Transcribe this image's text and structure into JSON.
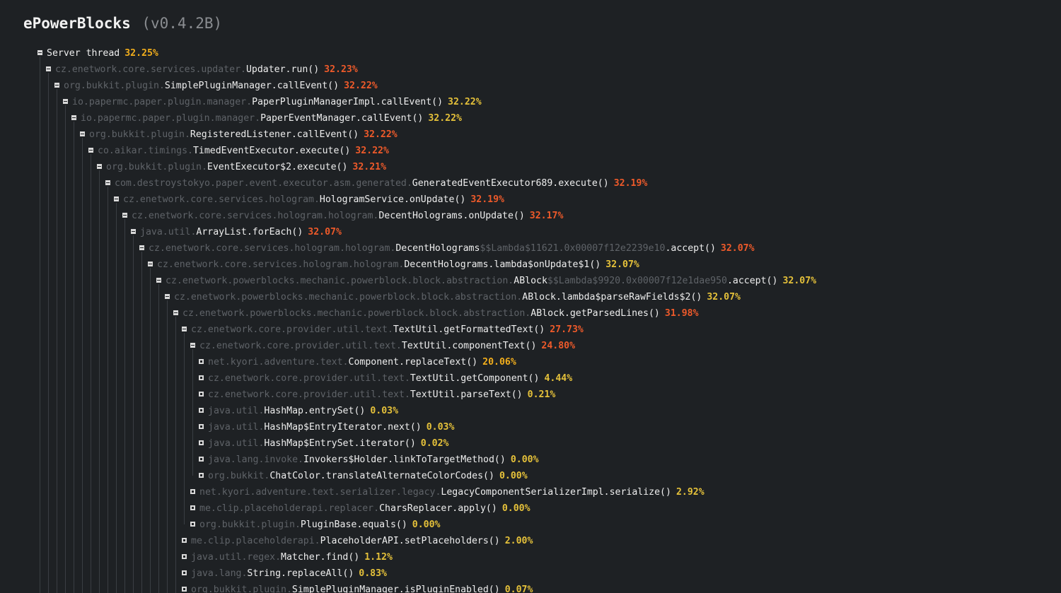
{
  "header": {
    "title": "ePowerBlocks",
    "version": "(v0.4.2B)"
  },
  "colors": {
    "background": "#1e2124",
    "package": "#5f6368",
    "method": "#eeeeee",
    "percent_high": "#ee5a2a",
    "percent_mid": "#f2ae1c",
    "percent_low": "#e5c13a"
  },
  "tree": [
    {
      "depth": 0,
      "expanded": true,
      "pkg": "",
      "cls": "Server thread",
      "pct": "32.25%",
      "heat": "mid"
    },
    {
      "depth": 1,
      "expanded": true,
      "pkg": "cz.enetwork.core.services.updater.",
      "cls": "Updater.run()",
      "pct": "32.23%",
      "heat": "high"
    },
    {
      "depth": 2,
      "expanded": true,
      "pkg": "org.bukkit.plugin.",
      "cls": "SimplePluginManager.callEvent()",
      "pct": "32.22%",
      "heat": "high"
    },
    {
      "depth": 3,
      "expanded": true,
      "pkg": "io.papermc.paper.plugin.manager.",
      "cls": "PaperPluginManagerImpl.callEvent()",
      "pct": "32.22%",
      "heat": "low"
    },
    {
      "depth": 4,
      "expanded": true,
      "pkg": "io.papermc.paper.plugin.manager.",
      "cls": "PaperEventManager.callEvent()",
      "pct": "32.22%",
      "heat": "low"
    },
    {
      "depth": 5,
      "expanded": true,
      "pkg": "org.bukkit.plugin.",
      "cls": "RegisteredListener.callEvent()",
      "pct": "32.22%",
      "heat": "high"
    },
    {
      "depth": 6,
      "expanded": true,
      "pkg": "co.aikar.timings.",
      "cls": "TimedEventExecutor.execute()",
      "pct": "32.22%",
      "heat": "high"
    },
    {
      "depth": 7,
      "expanded": true,
      "pkg": "org.bukkit.plugin.",
      "cls": "EventExecutor$2.execute()",
      "pct": "32.21%",
      "heat": "high"
    },
    {
      "depth": 8,
      "expanded": true,
      "pkg": "com.destroystokyo.paper.event.executor.asm.generated.",
      "cls": "GeneratedEventExecutor689.execute()",
      "pct": "32.19%",
      "heat": "high"
    },
    {
      "depth": 9,
      "expanded": true,
      "pkg": "cz.enetwork.core.services.hologram.",
      "cls": "HologramService.onUpdate()",
      "pct": "32.19%",
      "heat": "high"
    },
    {
      "depth": 10,
      "expanded": true,
      "pkg": "cz.enetwork.core.services.hologram.hologram.",
      "cls": "DecentHolograms.onUpdate()",
      "pct": "32.17%",
      "heat": "high"
    },
    {
      "depth": 11,
      "expanded": true,
      "pkg": "java.util.",
      "cls": "ArrayList.forEach()",
      "pct": "32.07%",
      "heat": "high"
    },
    {
      "depth": 12,
      "expanded": true,
      "pkg": "cz.enetwork.core.services.hologram.hologram.",
      "cls": "DecentHolograms",
      "lam": "$$Lambda$11621.0x00007f12e2239e10",
      "cls2": ".accept()",
      "pct": "32.07%",
      "heat": "high"
    },
    {
      "depth": 13,
      "expanded": true,
      "pkg": "cz.enetwork.core.services.hologram.hologram.",
      "cls": "DecentHolograms.lambda$onUpdate$1()",
      "pct": "32.07%",
      "heat": "low"
    },
    {
      "depth": 14,
      "expanded": true,
      "pkg": "cz.enetwork.powerblocks.mechanic.powerblock.block.abstraction.",
      "cls": "ABlock",
      "lam": "$$Lambda$9920.0x00007f12e1dae950",
      "cls2": ".accept()",
      "pct": "32.07%",
      "heat": "low"
    },
    {
      "depth": 15,
      "expanded": true,
      "pkg": "cz.enetwork.powerblocks.mechanic.powerblock.block.abstraction.",
      "cls": "ABlock.lambda$parseRawFields$2()",
      "pct": "32.07%",
      "heat": "low"
    },
    {
      "depth": 16,
      "expanded": true,
      "pkg": "cz.enetwork.powerblocks.mechanic.powerblock.block.abstraction.",
      "cls": "ABlock.getParsedLines()",
      "pct": "31.98%",
      "heat": "high"
    },
    {
      "depth": 17,
      "expanded": true,
      "pkg": "cz.enetwork.core.provider.util.text.",
      "cls": "TextUtil.getFormattedText()",
      "pct": "27.73%",
      "heat": "high"
    },
    {
      "depth": 18,
      "expanded": true,
      "pkg": "cz.enetwork.core.provider.util.text.",
      "cls": "TextUtil.componentText()",
      "pct": "24.80%",
      "heat": "high"
    },
    {
      "depth": 19,
      "expanded": false,
      "pkg": "net.kyori.adventure.text.",
      "cls": "Component.replaceText()",
      "pct": "20.06%",
      "heat": "mid"
    },
    {
      "depth": 19,
      "expanded": false,
      "pkg": "cz.enetwork.core.provider.util.text.",
      "cls": "TextUtil.getComponent()",
      "pct": "4.44%",
      "heat": "low"
    },
    {
      "depth": 19,
      "expanded": false,
      "pkg": "cz.enetwork.core.provider.util.text.",
      "cls": "TextUtil.parseText()",
      "pct": "0.21%",
      "heat": "low"
    },
    {
      "depth": 19,
      "expanded": false,
      "pkg": "java.util.",
      "cls": "HashMap.entrySet()",
      "pct": "0.03%",
      "heat": "low"
    },
    {
      "depth": 19,
      "expanded": false,
      "pkg": "java.util.",
      "cls": "HashMap$EntryIterator.next()",
      "pct": "0.03%",
      "heat": "low"
    },
    {
      "depth": 19,
      "expanded": false,
      "pkg": "java.util.",
      "cls": "HashMap$EntrySet.iterator()",
      "pct": "0.02%",
      "heat": "low"
    },
    {
      "depth": 19,
      "expanded": false,
      "pkg": "java.lang.invoke.",
      "cls": "Invokers$Holder.linkToTargetMethod()",
      "pct": "0.00%",
      "heat": "low"
    },
    {
      "depth": 19,
      "expanded": false,
      "pkg": "org.bukkit.",
      "cls": "ChatColor.translateAlternateColorCodes()",
      "pct": "0.00%",
      "heat": "low"
    },
    {
      "depth": 18,
      "expanded": false,
      "pkg": "net.kyori.adventure.text.serializer.legacy.",
      "cls": "LegacyComponentSerializerImpl.serialize()",
      "pct": "2.92%",
      "heat": "low"
    },
    {
      "depth": 18,
      "expanded": false,
      "pkg": "me.clip.placeholderapi.replacer.",
      "cls": "CharsReplacer.apply()",
      "pct": "0.00%",
      "heat": "low"
    },
    {
      "depth": 18,
      "expanded": false,
      "pkg": "org.bukkit.plugin.",
      "cls": "PluginBase.equals()",
      "pct": "0.00%",
      "heat": "low"
    },
    {
      "depth": 17,
      "expanded": false,
      "pkg": "me.clip.placeholderapi.",
      "cls": "PlaceholderAPI.setPlaceholders()",
      "pct": "2.00%",
      "heat": "low"
    },
    {
      "depth": 17,
      "expanded": false,
      "pkg": "java.util.regex.",
      "cls": "Matcher.find()",
      "pct": "1.12%",
      "heat": "low"
    },
    {
      "depth": 17,
      "expanded": false,
      "pkg": "java.lang.",
      "cls": "String.replaceAll()",
      "pct": "0.83%",
      "heat": "low"
    },
    {
      "depth": 17,
      "expanded": false,
      "pkg": "org.bukkit.plugin.",
      "cls": "SimplePluginManager.isPluginEnabled()",
      "pct": "0.07%",
      "heat": "low"
    }
  ]
}
